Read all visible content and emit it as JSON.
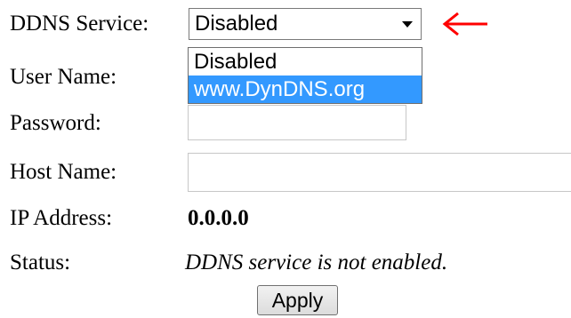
{
  "form": {
    "ddns_service": {
      "label": "DDNS Service:",
      "selected": "Disabled",
      "options": [
        "Disabled",
        "www.DynDNS.org"
      ],
      "highlighted_option": "www.DynDNS.org"
    },
    "user_name": {
      "label": "User Name:",
      "value": ""
    },
    "password": {
      "label": "Password:",
      "value": ""
    },
    "host_name": {
      "label": "Host Name:",
      "value": ""
    },
    "ip_address": {
      "label": "IP Address:",
      "value": "0.0.0.0"
    },
    "status": {
      "label": "Status:",
      "value": "DDNS service is not enabled."
    },
    "apply_label": "Apply"
  },
  "annotation": {
    "icon": "red-arrow-left-icon",
    "color": "#ff0000"
  },
  "colors": {
    "highlight": "#3399ff"
  }
}
